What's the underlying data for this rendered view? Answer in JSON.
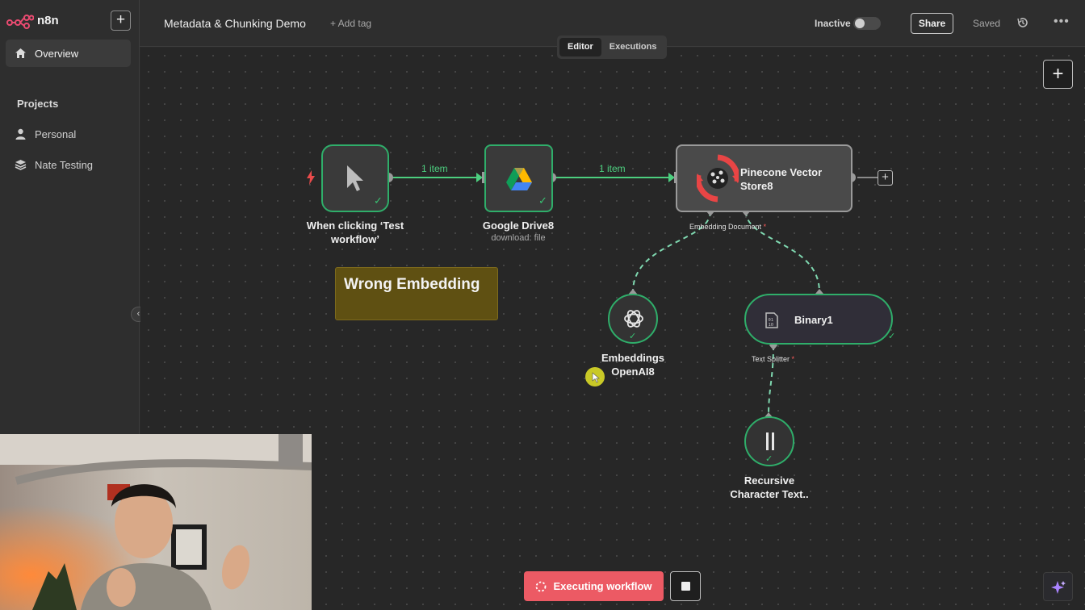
{
  "brand": {
    "name": "n8n"
  },
  "sidebar": {
    "add_label": "+",
    "overview": "Overview",
    "projects_heading": "Projects",
    "projects": [
      {
        "label": "Personal",
        "icon": "user-icon"
      },
      {
        "label": "Nate Testing",
        "icon": "layers-icon"
      }
    ],
    "collapse_label": "‹"
  },
  "header": {
    "title": "Metadata & Chunking Demo",
    "add_tag": "+ Add tag",
    "status_label": "Inactive",
    "share_label": "Share",
    "saved_label": "Saved",
    "more_label": "•••"
  },
  "tabs": [
    {
      "label": "Editor",
      "active": true
    },
    {
      "label": "Executions",
      "active": false
    }
  ],
  "canvas": {
    "add_label": "+",
    "nodes": {
      "trigger": {
        "label_line1": "When clicking ‘Test",
        "label_line2": "workflow’"
      },
      "drive": {
        "label": "Google Drive8",
        "sub": "download: file"
      },
      "pinecone": {
        "label_line1": "Pinecone Vector",
        "label_line2": "Store8",
        "sub_input": "Embedding Document"
      },
      "embeddings": {
        "label_line1": "Embeddings",
        "label_line2": "OpenAI8"
      },
      "binary": {
        "label": "Binary1",
        "sub_input": "Text Splitter"
      },
      "splitter": {
        "label_line1": "Recursive",
        "label_line2": "Character Text.."
      }
    },
    "connections": [
      {
        "label": "1 item"
      },
      {
        "label": "1 item"
      }
    ],
    "required_mark": "*",
    "sticky": {
      "text": "Wrong Embedding"
    }
  },
  "footer": {
    "executing_label": "Executing workflow"
  },
  "colors": {
    "success": "#2fae6a",
    "execute": "#ec5a64",
    "sticky": "#5f5012",
    "brand": "#ea4b71"
  }
}
